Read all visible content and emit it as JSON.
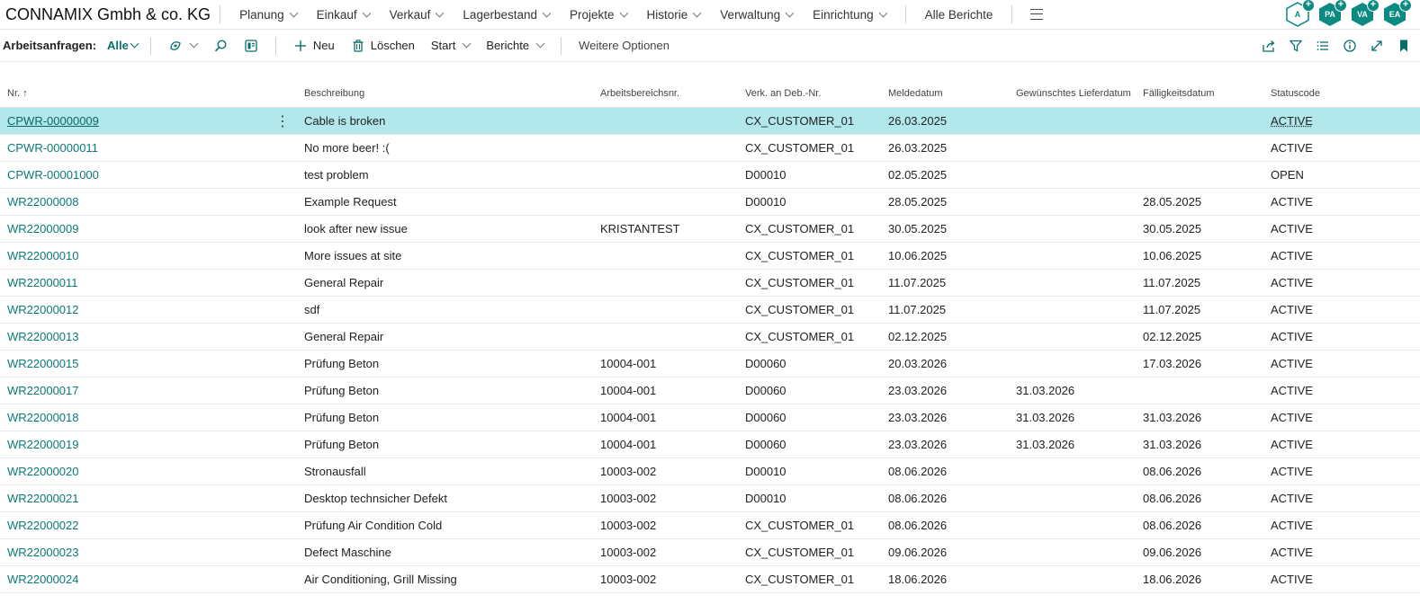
{
  "app": {
    "company": "CONNAMIX Gmbh & co. KG"
  },
  "nav": {
    "items": [
      "Planung",
      "Einkauf",
      "Verkauf",
      "Lagerbestand",
      "Projekte",
      "Historie",
      "Verwaltung",
      "Einrichtung"
    ],
    "all_reports": "Alle Berichte"
  },
  "avatars": [
    {
      "initials": "A",
      "filled": false
    },
    {
      "initials": "PA",
      "filled": true
    },
    {
      "initials": "VA",
      "filled": true
    },
    {
      "initials": "EA",
      "filled": true
    }
  ],
  "toolbar": {
    "title": "Arbeitsanfragen:",
    "filter": "Alle",
    "new_label": "Neu",
    "delete_label": "Löschen",
    "start_label": "Start",
    "reports_label": "Berichte",
    "more_label": "Weitere Optionen"
  },
  "table": {
    "headers": [
      "Nr. ↑",
      "Beschreibung",
      "Arbeitsbereichsnr.",
      "Verk. an Deb.-Nr.",
      "Meldedatum",
      "Gewünschtes Lieferdatum",
      "Fälligkeitsdatum",
      "Statuscode"
    ],
    "rows": [
      [
        "CPWR-00000009",
        "Cable is broken",
        "",
        "CX_CUSTOMER_01",
        "26.03.2025",
        "",
        "",
        "ACTIVE"
      ],
      [
        "CPWR-00000011",
        "No more beer! :(",
        "",
        "CX_CUSTOMER_01",
        "26.03.2025",
        "",
        "",
        "ACTIVE"
      ],
      [
        "CPWR-00001000",
        "test problem",
        "",
        "D00010",
        "02.05.2025",
        "",
        "",
        "OPEN"
      ],
      [
        "WR22000008",
        "Example Request",
        "",
        "D00010",
        "28.05.2025",
        "",
        "28.05.2025",
        "ACTIVE"
      ],
      [
        "WR22000009",
        "look after new issue",
        "KRISTANTEST",
        "CX_CUSTOMER_01",
        "30.05.2025",
        "",
        "30.05.2025",
        "ACTIVE"
      ],
      [
        "WR22000010",
        "More issues at site",
        "",
        "CX_CUSTOMER_01",
        "10.06.2025",
        "",
        "10.06.2025",
        "ACTIVE"
      ],
      [
        "WR22000011",
        "General Repair",
        "",
        "CX_CUSTOMER_01",
        "11.07.2025",
        "",
        "11.07.2025",
        "ACTIVE"
      ],
      [
        "WR22000012",
        "sdf",
        "",
        "CX_CUSTOMER_01",
        "11.07.2025",
        "",
        "11.07.2025",
        "ACTIVE"
      ],
      [
        "WR22000013",
        "General Repair",
        "",
        "CX_CUSTOMER_01",
        "02.12.2025",
        "",
        "02.12.2025",
        "ACTIVE"
      ],
      [
        "WR22000015",
        "Prüfung Beton",
        "10004-001",
        "D00060",
        "20.03.2026",
        "",
        "17.03.2026",
        "ACTIVE"
      ],
      [
        "WR22000017",
        "Prüfung Beton",
        "10004-001",
        "D00060",
        "23.03.2026",
        "31.03.2026",
        "",
        "ACTIVE"
      ],
      [
        "WR22000018",
        "Prüfung Beton",
        "10004-001",
        "D00060",
        "23.03.2026",
        "31.03.2026",
        "31.03.2026",
        "ACTIVE"
      ],
      [
        "WR22000019",
        "Prüfung Beton",
        "10004-001",
        "D00060",
        "23.03.2026",
        "31.03.2026",
        "31.03.2026",
        "ACTIVE"
      ],
      [
        "WR22000020",
        "Stronausfall",
        "10003-002",
        "D00010",
        "08.06.2026",
        "",
        "08.06.2026",
        "ACTIVE"
      ],
      [
        "WR22000021",
        "Desktop technsicher Defekt",
        "10003-002",
        "D00010",
        "08.06.2026",
        "",
        "08.06.2026",
        "ACTIVE"
      ],
      [
        "WR22000022",
        "Prüfung Air Condition Cold",
        "10003-002",
        "CX_CUSTOMER_01",
        "08.06.2026",
        "",
        "08.06.2026",
        "ACTIVE"
      ],
      [
        "WR22000023",
        "Defect Maschine",
        "10003-002",
        "CX_CUSTOMER_01",
        "09.06.2026",
        "",
        "09.06.2026",
        "ACTIVE"
      ],
      [
        "WR22000024",
        "Air Conditioning, Grill Missing",
        "10003-002",
        "CX_CUSTOMER_01",
        "18.06.2026",
        "",
        "18.06.2026",
        "ACTIVE"
      ]
    ]
  }
}
